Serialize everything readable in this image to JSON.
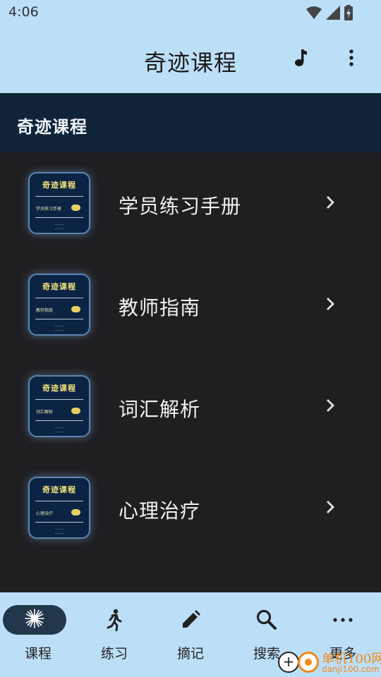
{
  "status_bar": {
    "time": "4:06",
    "icons": [
      "wifi-icon",
      "signal-icon",
      "battery-charging-icon"
    ]
  },
  "app_bar": {
    "title": "奇迹课程",
    "actions": [
      "music-note-icon",
      "more-vert-icon"
    ]
  },
  "section": {
    "title": "奇迹课程"
  },
  "course_list": [
    {
      "label": "学员练习手册",
      "cover_title": "奇迹课程",
      "cover_subtitle": "学员练习手册"
    },
    {
      "label": "教师指南",
      "cover_title": "奇迹课程",
      "cover_subtitle": "教师指南"
    },
    {
      "label": "词汇解析",
      "cover_title": "奇迹课程",
      "cover_subtitle": "词汇解析"
    },
    {
      "label": "心理治疗",
      "cover_title": "奇迹课程",
      "cover_subtitle": "心理治疗"
    }
  ],
  "bottom_nav": [
    {
      "label": "课程",
      "icon": "sparkle-icon",
      "active": true
    },
    {
      "label": "练习",
      "icon": "walking-person-icon",
      "active": false
    },
    {
      "label": "摘记",
      "icon": "pencil-icon",
      "active": false
    },
    {
      "label": "搜索",
      "icon": "search-icon",
      "active": false
    },
    {
      "label": "更多",
      "icon": "more-horiz-icon",
      "active": false
    }
  ],
  "watermark": {
    "text": "单机100网",
    "url_text": "danji100.com"
  },
  "colors": {
    "app_bar_bg": "#bcdff8",
    "section_header_bg": "#0f2439",
    "list_bg": "#1f1f22",
    "cover_bg": "#0b2443",
    "cover_title": "#f4e27a",
    "nav_active_pill": "#23374c",
    "watermark_orange": "#f08a1c"
  }
}
